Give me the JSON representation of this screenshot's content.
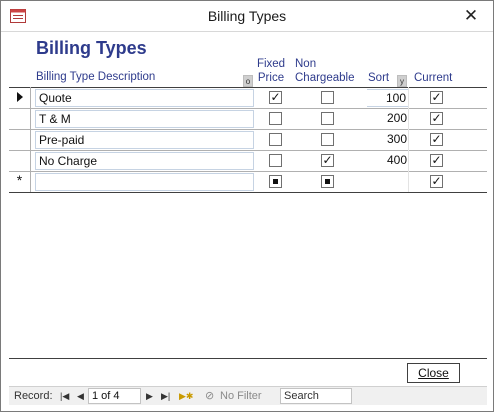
{
  "window": {
    "title": "Billing Types"
  },
  "form": {
    "title": "Billing Types"
  },
  "headers": {
    "description": "Billing Type Description",
    "description_sort_glyph": "o",
    "fixed_price_line1": "Fixed",
    "fixed_price_line2": "Price",
    "non_chargeable_line1": "Non",
    "non_chargeable_line2": "Chargeable",
    "sort": "Sort",
    "sort_glyph": "y",
    "current": "Current"
  },
  "rows": [
    {
      "description": "Quote",
      "fixed_price": true,
      "non_chargeable": false,
      "sort": "100",
      "current": true,
      "selected": true
    },
    {
      "description": "T & M",
      "fixed_price": false,
      "non_chargeable": false,
      "sort": "200",
      "current": true
    },
    {
      "description": "Pre-paid",
      "fixed_price": false,
      "non_chargeable": false,
      "sort": "300",
      "current": true
    },
    {
      "description": "No Charge",
      "fixed_price": false,
      "non_chargeable": true,
      "sort": "400",
      "current": true
    }
  ],
  "new_row": {
    "selector_glyph": "*",
    "description": "",
    "fixed_price": "null",
    "non_chargeable": "null",
    "sort": "",
    "current": true
  },
  "buttons": {
    "close": "Close"
  },
  "navigation": {
    "record_label": "Record:",
    "position": "1 of 4",
    "filter_label": "No Filter",
    "search_label": "Search"
  },
  "icons": {
    "app": "form-icon",
    "close": "close-icon",
    "current_record": "record-pointer-icon",
    "first": "first-record-icon",
    "previous": "previous-record-icon",
    "next": "next-record-icon",
    "last": "last-record-icon",
    "new": "new-record-icon",
    "filter": "filter-icon"
  }
}
